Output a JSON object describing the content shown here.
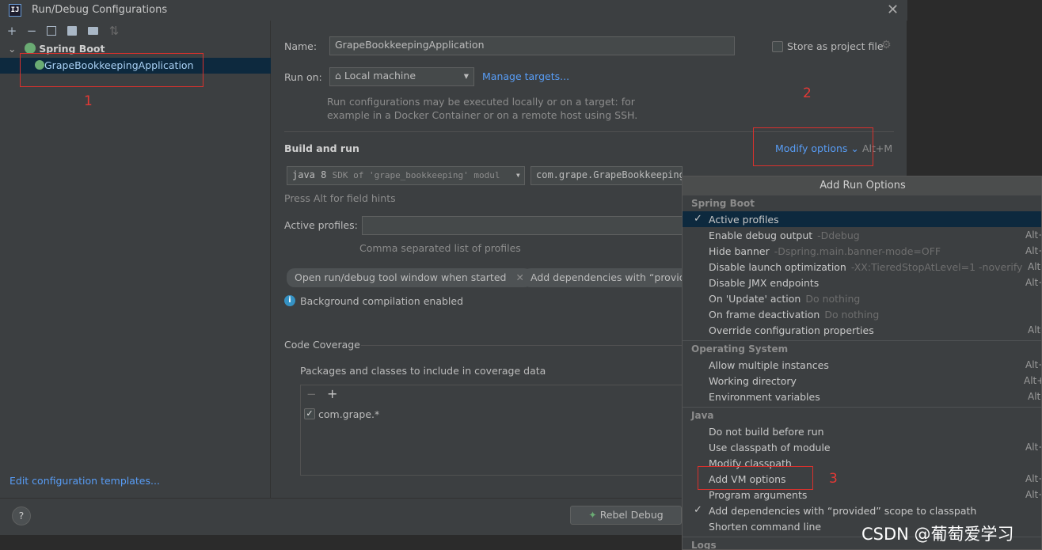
{
  "window": {
    "title": "Run/Debug Configurations",
    "app_icon_text": "IJ"
  },
  "toolbar": {
    "icons": [
      "plus-icon",
      "minus-icon",
      "copy-icon",
      "save-icon",
      "folder-icon",
      "sort-icon"
    ]
  },
  "tree": {
    "group_label": "Spring Boot",
    "selected_item": "GrapeBookkeepingApplication"
  },
  "annotations": {
    "one": "1",
    "two": "2",
    "three": "3"
  },
  "edit_templates_link": "Edit configuration templates...",
  "form": {
    "name_label": "Name:",
    "name_value": "GrapeBookkeepingApplication",
    "store_label": "Store as project file",
    "run_on_label": "Run on:",
    "run_on_value": "Local machine",
    "manage_targets": "Manage targets...",
    "run_on_hint_line1": "Run configurations may be executed locally or on a target: for",
    "run_on_hint_line2": "example in a Docker Container or on a remote host using SSH.",
    "build_and_run": "Build and run",
    "modify_options": "Modify options",
    "modify_shortcut": "Alt+M",
    "sdk_value_main": "java 8",
    "sdk_value_sub": "SDK of 'grape_bookkeeping' modul",
    "main_class": "com.grape.GrapeBookkeepingApplication",
    "field_hint": "Press Alt for field hints",
    "active_profiles_label": "Active profiles:",
    "active_profiles_hint": "Comma separated list of profiles",
    "chip1": "Open run/debug tool window when started",
    "chip2": "Add dependencies with “provide",
    "bg_compile": "Background compilation enabled",
    "code_coverage": "Code Coverage",
    "packages_label": "Packages and classes to include in coverage data",
    "coverage_entry": "com.grape.*"
  },
  "bottom": {
    "help": "?",
    "rebel_debug": "Rebel Debug"
  },
  "popup": {
    "title": "Add Run Options",
    "groups": {
      "spring_boot": "Spring Boot",
      "os": "Operating System",
      "java": "Java",
      "logs": "Logs"
    },
    "items": {
      "active_profiles": "Active profiles",
      "enable_debug": "Enable debug output",
      "enable_debug_sub": "-Ddebug",
      "hide_banner": "Hide banner",
      "hide_banner_sub": "-Dspring.main.banner-mode=OFF",
      "disable_launch": "Disable launch optimization",
      "disable_launch_sub": "-XX:TieredStopAtLevel=1 -noverify",
      "disable_jmx": "Disable JMX endpoints",
      "on_update": "On 'Update' action",
      "on_update_sub": "Do nothing",
      "on_frame": "On frame deactivation",
      "on_frame_sub": "Do nothing",
      "override_config": "Override configuration properties",
      "allow_multiple": "Allow multiple instances",
      "working_dir": "Working directory",
      "env_vars": "Environment variables",
      "no_build": "Do not build before run",
      "use_classpath": "Use classpath of module",
      "modify_classpath": "Modify classpath",
      "add_vm": "Add VM options",
      "program_args": "Program arguments",
      "add_deps": "Add dependencies with “provided” scope to classpath",
      "shorten_cmd": "Shorten command line"
    },
    "shortcut": "Alt+",
    "shortcut_short": "Alt-"
  },
  "watermark": "CSDN @葡萄爱学习"
}
